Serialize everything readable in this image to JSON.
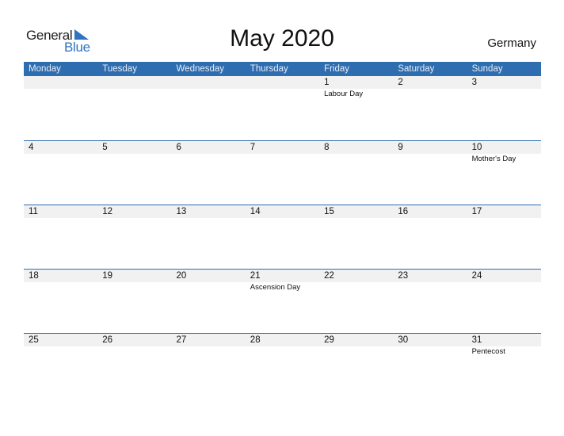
{
  "logo": {
    "part1": "General",
    "part2": "Blue",
    "accent": "#2e74c0"
  },
  "title": "May 2020",
  "country": "Germany",
  "colors": {
    "header_bg": "#2e6db0",
    "date_strip_bg": "#f1f1f1"
  },
  "weekdays": [
    "Monday",
    "Tuesday",
    "Wednesday",
    "Thursday",
    "Friday",
    "Saturday",
    "Sunday"
  ],
  "weeks": [
    {
      "days": [
        "",
        "",
        "",
        "",
        "1",
        "2",
        "3"
      ],
      "events": [
        "",
        "",
        "",
        "",
        "Labour Day",
        "",
        ""
      ]
    },
    {
      "days": [
        "4",
        "5",
        "6",
        "7",
        "8",
        "9",
        "10"
      ],
      "events": [
        "",
        "",
        "",
        "",
        "",
        "",
        "Mother's Day"
      ]
    },
    {
      "days": [
        "11",
        "12",
        "13",
        "14",
        "15",
        "16",
        "17"
      ],
      "events": [
        "",
        "",
        "",
        "",
        "",
        "",
        ""
      ]
    },
    {
      "days": [
        "18",
        "19",
        "20",
        "21",
        "22",
        "23",
        "24"
      ],
      "events": [
        "",
        "",
        "",
        "Ascension Day",
        "",
        "",
        ""
      ]
    },
    {
      "days": [
        "25",
        "26",
        "27",
        "28",
        "29",
        "30",
        "31"
      ],
      "events": [
        "",
        "",
        "",
        "",
        "",
        "",
        "Pentecost"
      ]
    }
  ]
}
